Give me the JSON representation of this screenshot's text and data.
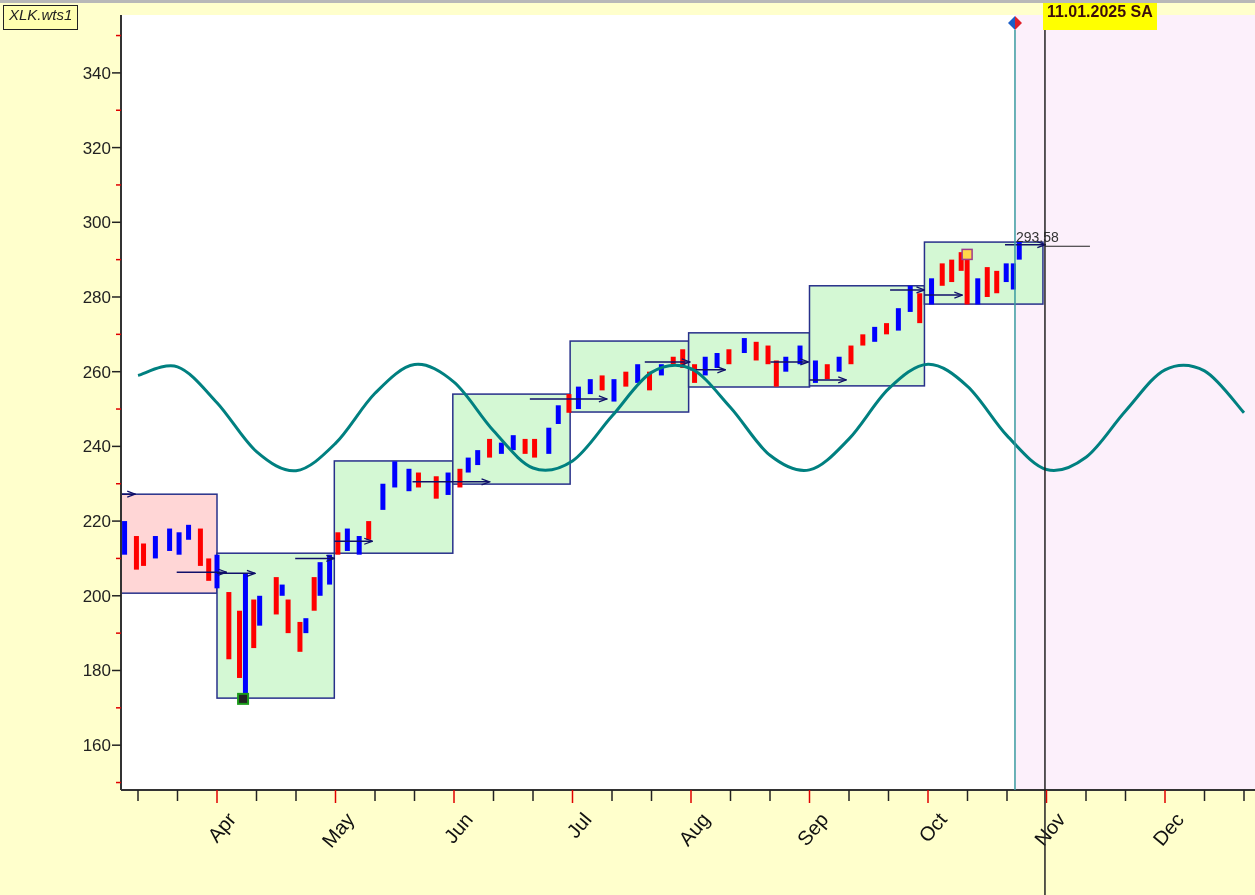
{
  "chart": {
    "symbol_label": "XLK.wts1",
    "date_label": "11.01.2025 SA",
    "price_label": "293.58",
    "chart_data": {
      "type": "line",
      "ylim": [
        148,
        355.5
      ],
      "yticks": [
        160,
        180,
        200,
        220,
        240,
        260,
        280,
        300,
        320,
        340
      ],
      "categories": [
        null,
        null,
        "Apr",
        null,
        null,
        "May",
        null,
        null,
        "Jun",
        null,
        null,
        "Jul",
        null,
        null,
        "Aug",
        null,
        null,
        "Sep",
        null,
        null,
        "Oct",
        null,
        null,
        "Nov",
        null,
        null,
        "Dec",
        null,
        null
      ],
      "series": [
        {
          "color": "#008080",
          "values": [
            259.0,
            261.3,
            251.7,
            238.6,
            233.5,
            240.8,
            254.2,
            261.9,
            257.2,
            244.2,
            234.2,
            236.1,
            248.1,
            259.8,
            260.8,
            250.4,
            237.6,
            233.7,
            242.0,
            255.4,
            262.0,
            256.1,
            242.9,
            233.8,
            237.1,
            249.5,
            260.5,
            260.2,
            249.0
          ]
        }
      ]
    }
  }
}
